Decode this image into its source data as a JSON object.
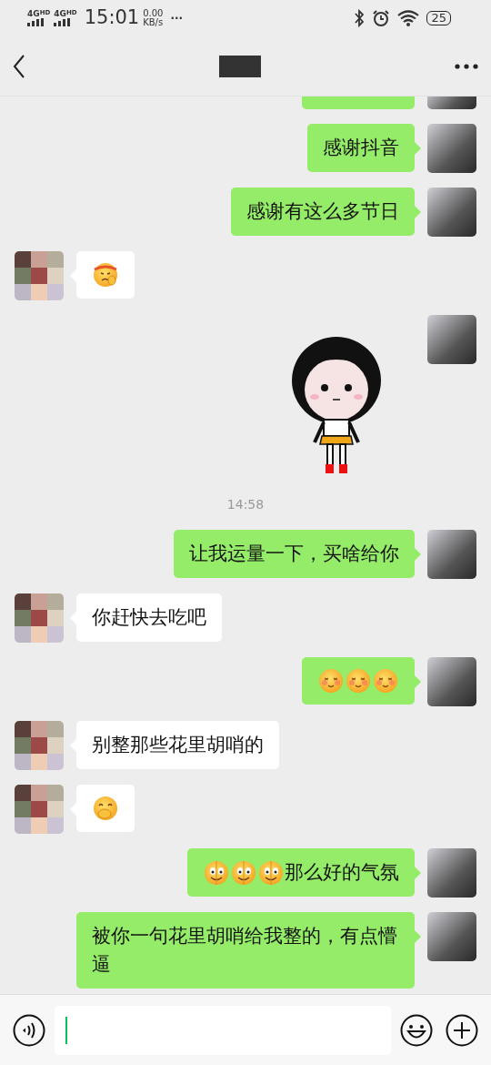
{
  "status_bar": {
    "networks": [
      {
        "label": "4G",
        "tag": "HD"
      },
      {
        "label": "4G",
        "tag": "HD"
      }
    ],
    "time": "15:01",
    "speed_value": "0.00",
    "speed_unit": "KB/s",
    "more": "···",
    "battery": "25"
  },
  "header": {
    "title_redacted": true
  },
  "messages": [
    {
      "kind": "partial",
      "outgoing": true
    },
    {
      "kind": "text",
      "outgoing": true,
      "parts": [
        {
          "kind": "text",
          "text": "感谢抖音"
        }
      ]
    },
    {
      "kind": "text",
      "outgoing": true,
      "parts": [
        {
          "kind": "text",
          "text": "感谢有这么多节日"
        }
      ]
    },
    {
      "kind": "text",
      "outgoing": false,
      "parts": [
        {
          "kind": "salute"
        }
      ]
    },
    {
      "kind": "sticker",
      "outgoing": true
    },
    {
      "kind": "time",
      "text": "14:58"
    },
    {
      "kind": "text",
      "outgoing": true,
      "parts": [
        {
          "kind": "text",
          "text": "让我运量一下，买啥给你"
        }
      ]
    },
    {
      "kind": "text",
      "outgoing": false,
      "parts": [
        {
          "kind": "text",
          "text": "你赶快去吃吧"
        }
      ]
    },
    {
      "kind": "text",
      "outgoing": true,
      "parts": [
        {
          "kind": "blush"
        },
        {
          "kind": "blush"
        },
        {
          "kind": "blush"
        }
      ]
    },
    {
      "kind": "text",
      "outgoing": false,
      "parts": [
        {
          "kind": "text",
          "text": "别整那些花里胡哨的"
        }
      ]
    },
    {
      "kind": "text",
      "outgoing": false,
      "parts": [
        {
          "kind": "giggle"
        }
      ]
    },
    {
      "kind": "text",
      "outgoing": true,
      "parts": [
        {
          "kind": "dizzy"
        },
        {
          "kind": "dizzy"
        },
        {
          "kind": "dizzy"
        },
        {
          "kind": "text",
          "text": "那么好的气氛"
        }
      ]
    },
    {
      "kind": "text",
      "outgoing": true,
      "parts": [
        {
          "kind": "text",
          "text": "被你一句花里胡哨给我整的，有点懵逼"
        }
      ]
    }
  ]
}
